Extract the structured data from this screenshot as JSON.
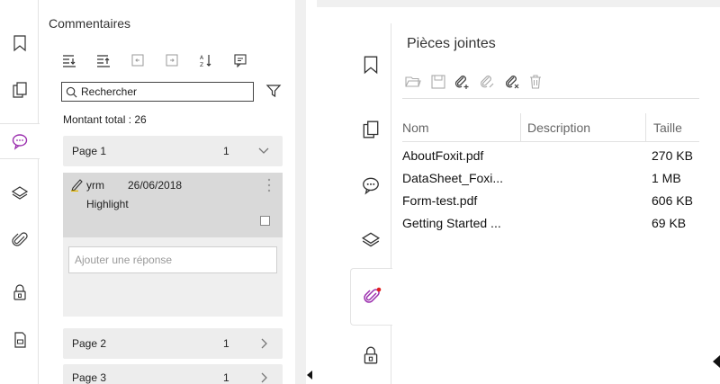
{
  "left": {
    "title": "Commentaires",
    "search": {
      "value": "Rechercher"
    },
    "total": "Montant total : 26",
    "pages": [
      {
        "label": "Page 1",
        "count": "1",
        "expanded": true
      },
      {
        "label": "Page 2",
        "count": "1",
        "expanded": false
      },
      {
        "label": "Page 3",
        "count": "1",
        "expanded": false
      }
    ],
    "comment": {
      "author": "yrm",
      "date": "26/06/2018",
      "type": "Highlight"
    },
    "reply_placeholder": "Ajouter une réponse",
    "rail_icons": [
      "bookmark-icon",
      "pages-icon",
      "comments-icon",
      "layers-icon",
      "attachment-icon",
      "lock-icon",
      "form-icon"
    ],
    "toolbar_icons": [
      "expand-all-icon",
      "collapse-all-icon",
      "previous-icon",
      "next-icon",
      "sort-icon",
      "comment-options-icon"
    ],
    "accent": "#9b2fae"
  },
  "right": {
    "title": "Pièces jointes",
    "toolbar_icons": [
      "open-icon",
      "save-icon",
      "add-attachment-icon",
      "edit-attachment-icon",
      "delete-attachment-icon",
      "trash-icon"
    ],
    "columns": [
      "Nom",
      "Description",
      "Taille"
    ],
    "files": [
      {
        "name": "AboutFoxit.pdf",
        "description": "",
        "size": "270 KB"
      },
      {
        "name": "DataSheet_Foxi...",
        "description": "",
        "size": "1 MB"
      },
      {
        "name": "Form-test.pdf",
        "description": "",
        "size": "606 KB"
      },
      {
        "name": "Getting Started ...",
        "description": "",
        "size": "69 KB"
      }
    ],
    "rail_icons": [
      "bookmark-icon",
      "pages-icon",
      "comments-icon",
      "layers-icon",
      "attachment-icon",
      "lock-icon"
    ],
    "accent": "#9b2fae",
    "notification_color": "#e02020"
  }
}
